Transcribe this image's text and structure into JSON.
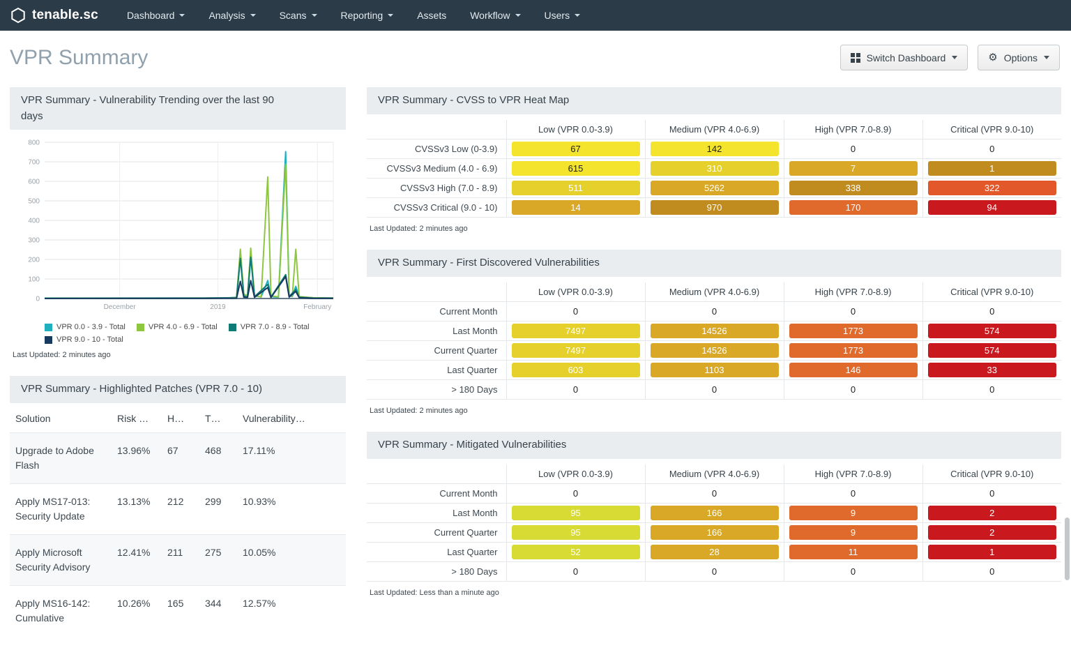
{
  "theme": {
    "nav_bg": "#2c3b48",
    "panel_header_bg": "#e9edf0",
    "title_color": "#90a1ad"
  },
  "nav": {
    "brand": "tenable.sc",
    "items": [
      {
        "label": "Dashboard",
        "caret": true
      },
      {
        "label": "Analysis",
        "caret": true
      },
      {
        "label": "Scans",
        "caret": true
      },
      {
        "label": "Reporting",
        "caret": true
      },
      {
        "label": "Assets",
        "caret": false
      },
      {
        "label": "Workflow",
        "caret": true
      },
      {
        "label": "Users",
        "caret": true
      }
    ]
  },
  "header": {
    "title": "VPR Summary",
    "switch_dashboard": "Switch Dashboard",
    "options": "Options"
  },
  "palette": {
    "y1": {
      "bg": "#f5e42d",
      "fg": "#222222"
    },
    "y2": {
      "bg": "#e6d12c",
      "fg": "#ffffff"
    },
    "yg": {
      "bg": "#d7db33",
      "fg": "#ffffff"
    },
    "gold": {
      "bg": "#d8a826",
      "fg": "#ffffff"
    },
    "dgold": {
      "bg": "#c08c20",
      "fg": "#ffffff"
    },
    "orange": {
      "bg": "#e06a2b",
      "fg": "#ffffff"
    },
    "orange2": {
      "bg": "#e2582a",
      "fg": "#ffffff"
    },
    "red": {
      "bg": "#c9181e",
      "fg": "#ffffff"
    }
  },
  "columns": [
    "Low (VPR 0.0-3.9)",
    "Medium (VPR 4.0-6.9)",
    "High (VPR 7.0-8.9)",
    "Critical (VPR 9.0-10)"
  ],
  "trend_panel": {
    "last_updated": "Last Updated: 2 minutes ago",
    "chart_data": {
      "type": "line",
      "title": "VPR Summary - Vulnerability Trending over the last 90 days",
      "xlabel": "",
      "ylabel": "",
      "ylim": [
        0,
        800
      ],
      "yticks": [
        0,
        100,
        200,
        300,
        400,
        500,
        600,
        700,
        800
      ],
      "grid": true,
      "legend_position": "bottom",
      "xticks": [
        {
          "label": "December",
          "pos": 0.26
        },
        {
          "label": "2019",
          "pos": 0.6
        },
        {
          "label": "February",
          "pos": 0.945
        }
      ],
      "series": [
        {
          "name": "VPR 0.0 - 3.9 - Total",
          "color": "#1fb0c0",
          "points": [
            [
              0,
              2
            ],
            [
              0.55,
              3
            ],
            [
              0.64,
              4
            ],
            [
              0.665,
              6
            ],
            [
              0.678,
              228
            ],
            [
              0.69,
              18
            ],
            [
              0.703,
              12
            ],
            [
              0.714,
              238
            ],
            [
              0.727,
              14
            ],
            [
              0.75,
              8
            ],
            [
              0.773,
              92
            ],
            [
              0.784,
              10
            ],
            [
              0.81,
              6
            ],
            [
              0.835,
              752
            ],
            [
              0.847,
              16
            ],
            [
              0.858,
              10
            ],
            [
              0.87,
              62
            ],
            [
              0.882,
              8
            ],
            [
              0.93,
              4
            ],
            [
              1,
              3
            ]
          ]
        },
        {
          "name": "VPR 4.0 - 6.9 - Total",
          "color": "#8dc63f",
          "points": [
            [
              0,
              1
            ],
            [
              0.55,
              2
            ],
            [
              0.64,
              3
            ],
            [
              0.665,
              5
            ],
            [
              0.678,
              252
            ],
            [
              0.69,
              22
            ],
            [
              0.703,
              14
            ],
            [
              0.714,
              258
            ],
            [
              0.727,
              16
            ],
            [
              0.75,
              8
            ],
            [
              0.773,
              622
            ],
            [
              0.784,
              14
            ],
            [
              0.81,
              8
            ],
            [
              0.835,
              688
            ],
            [
              0.847,
              18
            ],
            [
              0.858,
              12
            ],
            [
              0.87,
              252
            ],
            [
              0.882,
              10
            ],
            [
              0.93,
              4
            ],
            [
              1,
              2
            ]
          ]
        },
        {
          "name": "VPR 7.0 - 8.9 - Total",
          "color": "#0e7c74",
          "points": [
            [
              0,
              1
            ],
            [
              0.55,
              1
            ],
            [
              0.665,
              3
            ],
            [
              0.678,
              205
            ],
            [
              0.69,
              10
            ],
            [
              0.703,
              8
            ],
            [
              0.714,
              212
            ],
            [
              0.727,
              9
            ],
            [
              0.773,
              72
            ],
            [
              0.784,
              7
            ],
            [
              0.835,
              122
            ],
            [
              0.847,
              10
            ],
            [
              0.87,
              46
            ],
            [
              0.882,
              6
            ],
            [
              0.93,
              2
            ],
            [
              1,
              1
            ]
          ]
        },
        {
          "name": "VPR 9.0 - 10 - Total",
          "color": "#173a5e",
          "points": [
            [
              0,
              0
            ],
            [
              0.55,
              1
            ],
            [
              0.665,
              2
            ],
            [
              0.678,
              88
            ],
            [
              0.69,
              6
            ],
            [
              0.703,
              5
            ],
            [
              0.714,
              92
            ],
            [
              0.727,
              6
            ],
            [
              0.773,
              56
            ],
            [
              0.784,
              5
            ],
            [
              0.835,
              112
            ],
            [
              0.847,
              7
            ],
            [
              0.87,
              36
            ],
            [
              0.882,
              4
            ],
            [
              0.93,
              1
            ],
            [
              1,
              1
            ]
          ]
        }
      ]
    }
  },
  "patches_panel": {
    "title": "VPR Summary - Highlighted Patches (VPR 7.0 - 10)",
    "columns": [
      "Solution",
      "Risk …",
      "H…",
      "T…",
      "Vulnerability…"
    ],
    "rows": [
      [
        "Upgrade to Adobe Flash",
        "13.96%",
        "67",
        "468",
        "17.11%"
      ],
      [
        "Apply MS17-013: Security Update",
        "13.13%",
        "212",
        "299",
        "10.93%"
      ],
      [
        "Apply Microsoft Security Advisory",
        "12.41%",
        "211",
        "275",
        "10.05%"
      ],
      [
        "Apply MS16-142: Cumulative",
        "10.26%",
        "165",
        "344",
        "12.57%"
      ]
    ]
  },
  "heatmap_panel": {
    "title": "VPR Summary - CVSS to VPR Heat Map",
    "rows": [
      {
        "label": "CVSSv3 Low (0-3.9)",
        "cells": [
          {
            "v": "67",
            "k": "y1"
          },
          {
            "v": "142",
            "k": "y1"
          },
          {
            "v": "0"
          },
          {
            "v": "0"
          }
        ]
      },
      {
        "label": "CVSSv3 Medium (4.0 - 6.9)",
        "cells": [
          {
            "v": "615",
            "k": "y1"
          },
          {
            "v": "310",
            "k": "y2"
          },
          {
            "v": "7",
            "k": "gold"
          },
          {
            "v": "1",
            "k": "dgold"
          }
        ]
      },
      {
        "label": "CVSSv3 High (7.0 - 8.9)",
        "cells": [
          {
            "v": "511",
            "k": "y2"
          },
          {
            "v": "5262",
            "k": "gold"
          },
          {
            "v": "338",
            "k": "dgold"
          },
          {
            "v": "322",
            "k": "orange2"
          }
        ]
      },
      {
        "label": "CVSSv3 Critical (9.0 - 10)",
        "cells": [
          {
            "v": "14",
            "k": "gold"
          },
          {
            "v": "970",
            "k": "dgold"
          },
          {
            "v": "170",
            "k": "orange"
          },
          {
            "v": "94",
            "k": "red"
          }
        ]
      }
    ],
    "last_updated": "Last Updated: 2 minutes ago"
  },
  "first_discovered_panel": {
    "title": "VPR Summary - First Discovered Vulnerabilities",
    "rows": [
      {
        "label": "Current Month",
        "cells": [
          {
            "v": "0"
          },
          {
            "v": "0"
          },
          {
            "v": "0"
          },
          {
            "v": "0"
          }
        ]
      },
      {
        "label": "Last Month",
        "cells": [
          {
            "v": "7497",
            "k": "y2"
          },
          {
            "v": "14526",
            "k": "gold"
          },
          {
            "v": "1773",
            "k": "orange"
          },
          {
            "v": "574",
            "k": "red"
          }
        ]
      },
      {
        "label": "Current Quarter",
        "cells": [
          {
            "v": "7497",
            "k": "y2"
          },
          {
            "v": "14526",
            "k": "gold"
          },
          {
            "v": "1773",
            "k": "orange"
          },
          {
            "v": "574",
            "k": "red"
          }
        ]
      },
      {
        "label": "Last Quarter",
        "cells": [
          {
            "v": "603",
            "k": "y2"
          },
          {
            "v": "1103",
            "k": "gold"
          },
          {
            "v": "146",
            "k": "orange"
          },
          {
            "v": "33",
            "k": "red"
          }
        ]
      },
      {
        "label": "> 180 Days",
        "cells": [
          {
            "v": "0"
          },
          {
            "v": "0"
          },
          {
            "v": "0"
          },
          {
            "v": "0"
          }
        ]
      }
    ],
    "last_updated": "Last Updated: 2 minutes ago"
  },
  "mitigated_panel": {
    "title": "VPR Summary - Mitigated Vulnerabilities",
    "rows": [
      {
        "label": "Current Month",
        "cells": [
          {
            "v": "0"
          },
          {
            "v": "0"
          },
          {
            "v": "0"
          },
          {
            "v": "0"
          }
        ]
      },
      {
        "label": "Last Month",
        "cells": [
          {
            "v": "95",
            "k": "yg"
          },
          {
            "v": "166",
            "k": "gold"
          },
          {
            "v": "9",
            "k": "orange"
          },
          {
            "v": "2",
            "k": "red"
          }
        ]
      },
      {
        "label": "Current Quarter",
        "cells": [
          {
            "v": "95",
            "k": "yg"
          },
          {
            "v": "166",
            "k": "gold"
          },
          {
            "v": "9",
            "k": "orange"
          },
          {
            "v": "2",
            "k": "red"
          }
        ]
      },
      {
        "label": "Last Quarter",
        "cells": [
          {
            "v": "52",
            "k": "yg"
          },
          {
            "v": "28",
            "k": "gold"
          },
          {
            "v": "11",
            "k": "orange"
          },
          {
            "v": "1",
            "k": "red"
          }
        ]
      },
      {
        "label": "> 180 Days",
        "cells": [
          {
            "v": "0"
          },
          {
            "v": "0"
          },
          {
            "v": "0"
          },
          {
            "v": "0"
          }
        ]
      }
    ],
    "last_updated": "Last Updated: Less than a minute ago"
  }
}
